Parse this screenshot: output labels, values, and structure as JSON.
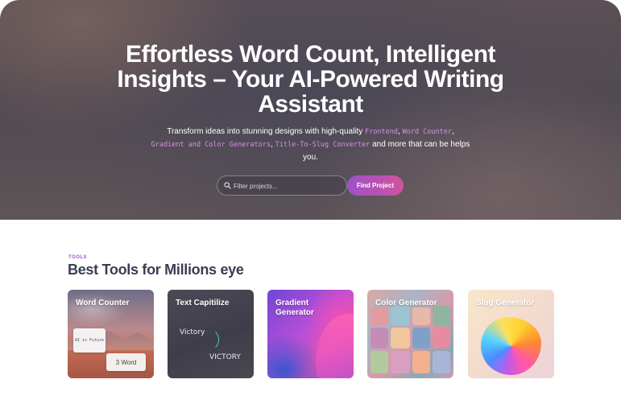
{
  "hero": {
    "title": "Effortless Word Count, Intelligent Insights – Your AI-Powered Writing Assistant",
    "subtitle_parts": {
      "before": "Transform ideas into stunning designs with high-quality ",
      "code1": "Frontend",
      "sep1": ", ",
      "code2": "Word Counter",
      "sep2": ", ",
      "code3": "Gradient and Color Generators",
      "sep3": ", ",
      "code4": "Title-To-Slug Converter",
      "after": " and more that can be helps you."
    },
    "search": {
      "placeholder": "Filter projects..."
    },
    "find_button": "Find Project"
  },
  "tools": {
    "tag": "TOOLS",
    "title": "Best Tools for Millions eye",
    "cards": [
      {
        "title": "Word Counter",
        "box1": "AI is Future",
        "box2": "3 Word"
      },
      {
        "title": "Text Capitilize",
        "word1": "Victory",
        "word2": "VICTORY"
      },
      {
        "title": "Gradient Generator"
      },
      {
        "title": "Color Generator"
      },
      {
        "title": "Slug Generator"
      }
    ]
  },
  "colors": {
    "accent_purple": "#9b52c9",
    "accent_pink": "#d0539d",
    "code_text": "#d68fe6",
    "section_title": "#3a3d55"
  }
}
